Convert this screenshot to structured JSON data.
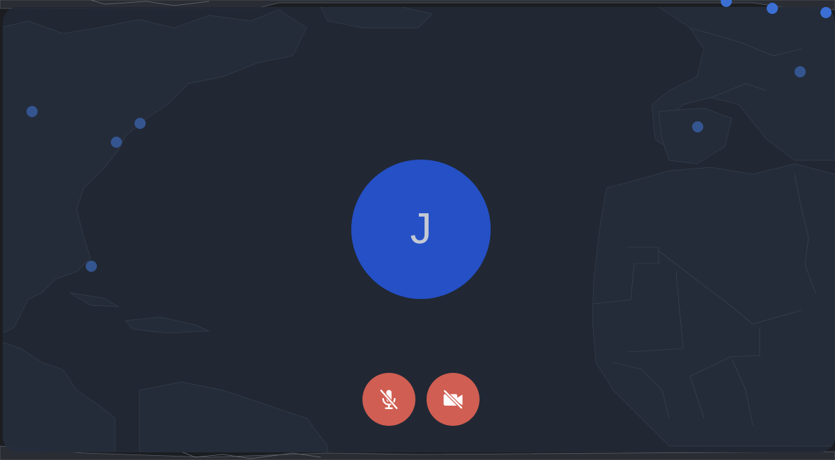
{
  "participant": {
    "initial": "J",
    "avatar_color": "#2550c6"
  },
  "controls": {
    "mic": {
      "state": "muted",
      "icon": "mic-off-icon"
    },
    "camera": {
      "state": "off",
      "icon": "video-off-icon"
    },
    "button_color": "#d05e52"
  },
  "map": {
    "background_color": "#1b1d21",
    "tile_color": "#212936",
    "marker_color": "#3b6fd4"
  }
}
